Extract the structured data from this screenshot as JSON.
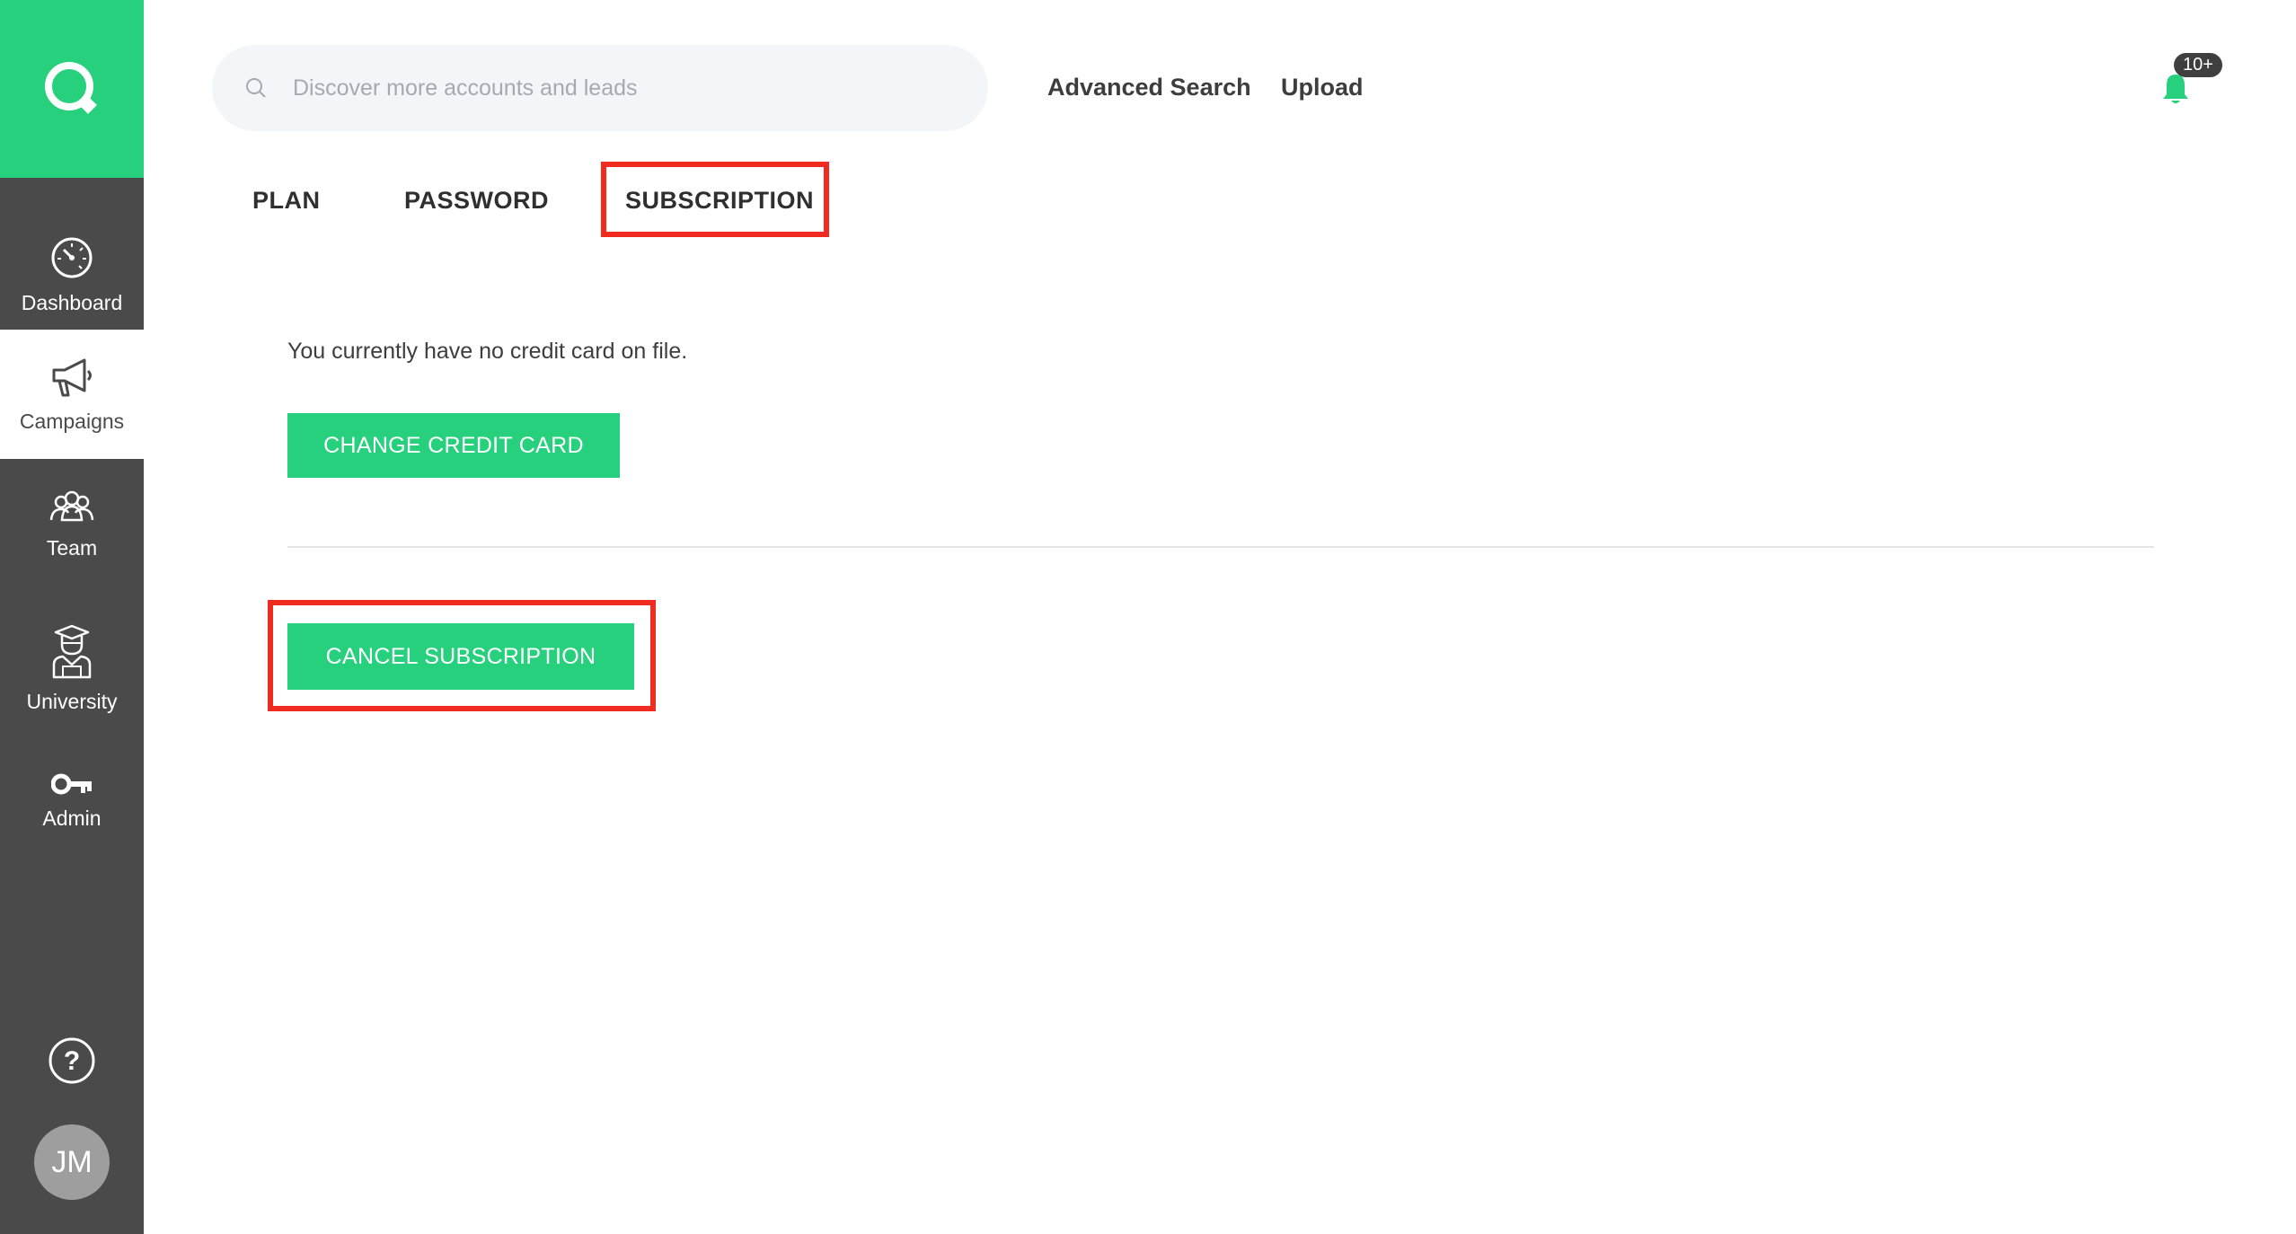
{
  "sidebar": {
    "items": [
      {
        "label": "Dashboard",
        "icon": "dashboard-gauge-icon"
      },
      {
        "label": "Campaigns",
        "icon": "megaphone-icon",
        "active": true
      },
      {
        "label": "Team",
        "icon": "team-icon"
      },
      {
        "label": "University",
        "icon": "graduate-icon"
      },
      {
        "label": "Admin",
        "icon": "key-icon"
      }
    ],
    "avatar_initials": "JM"
  },
  "header": {
    "search_placeholder": "Discover more accounts and leads",
    "advanced_search": "Advanced Search",
    "upload": "Upload",
    "notification_badge": "10+"
  },
  "tabs": [
    {
      "label": "PLAN"
    },
    {
      "label": "PASSWORD"
    },
    {
      "label": "SUBSCRIPTION",
      "active": true
    }
  ],
  "subscription": {
    "card_message": "You currently have no credit card on file.",
    "change_card_label": "CHANGE CREDIT CARD",
    "cancel_label": "CANCEL SUBSCRIPTION"
  },
  "colors": {
    "accent": "#26d07c",
    "sidebar": "#4a4a4a",
    "highlight": "#f02b1f"
  }
}
